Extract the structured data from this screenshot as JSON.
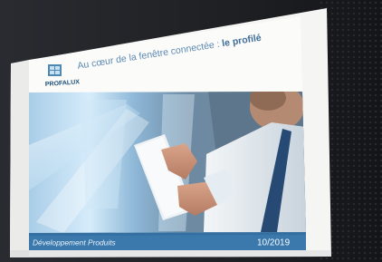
{
  "slide": {
    "brand": "PROFALUX",
    "title_prefix": "Au cœur de la fenêtre connectée : ",
    "title_highlight": "le profilé",
    "footer_left": "Développement Produits",
    "footer_right": "10/2019"
  },
  "colors": {
    "brand_blue": "#1d4f7a",
    "title_blue": "#5d8ab2",
    "footer_bar": "#3b79ad",
    "footer_text": "#e9f2fa",
    "room_dark": "#1d1e22"
  }
}
